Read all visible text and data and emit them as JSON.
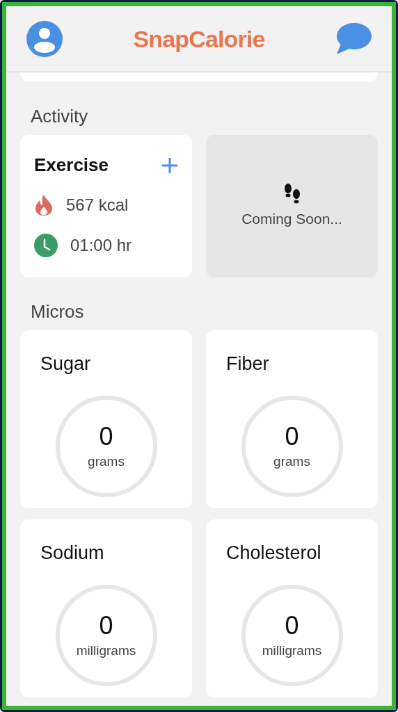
{
  "header": {
    "title": "SnapCalorie"
  },
  "activity": {
    "heading": "Activity",
    "exercise": {
      "title": "Exercise",
      "calories": "567 kcal",
      "duration": "01:00 hr"
    },
    "steps": {
      "message": "Coming Soon..."
    }
  },
  "micros": {
    "heading": "Micros",
    "items": [
      {
        "name": "Sugar",
        "value": "0",
        "unit": "grams"
      },
      {
        "name": "Fiber",
        "value": "0",
        "unit": "grams"
      },
      {
        "name": "Sodium",
        "value": "0",
        "unit": "milligrams"
      },
      {
        "name": "Cholesterol",
        "value": "0",
        "unit": "milligrams"
      }
    ]
  }
}
